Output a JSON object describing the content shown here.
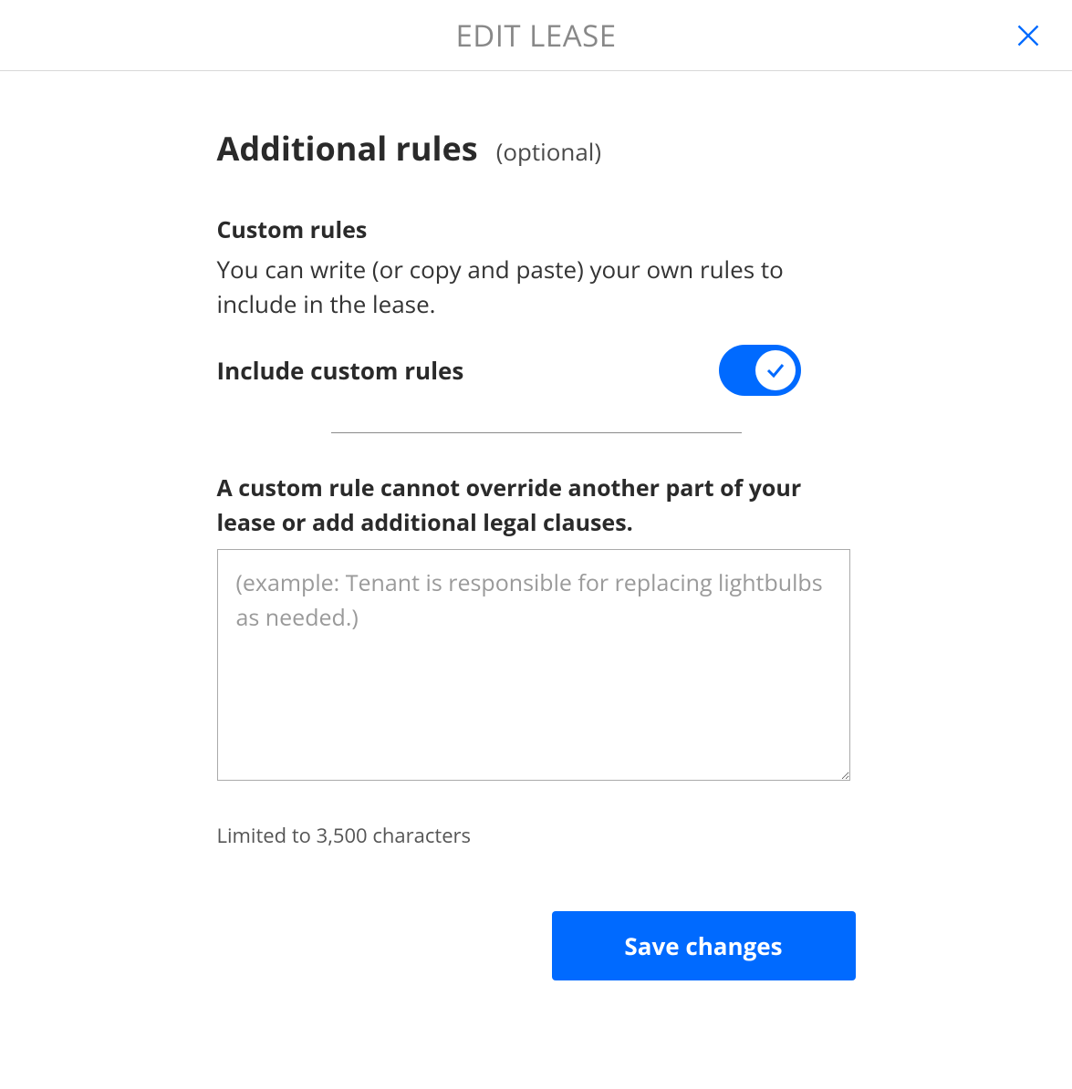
{
  "modal": {
    "title": "EDIT LEASE"
  },
  "section": {
    "title": "Additional rules",
    "optional": "(optional)"
  },
  "customRules": {
    "heading": "Custom rules",
    "description": "You can write (or copy and paste) your own rules to include in the lease.",
    "toggleLabel": "Include custom rules",
    "toggleOn": true,
    "note": "A custom rule cannot override another part of your lease or add additional legal clauses.",
    "textareaPlaceholder": "(example: Tenant is responsible for replacing lightbulbs as needed.)",
    "textareaValue": "",
    "limitText": "Limited to 3,500 characters"
  },
  "actions": {
    "saveLabel": "Save changes"
  }
}
